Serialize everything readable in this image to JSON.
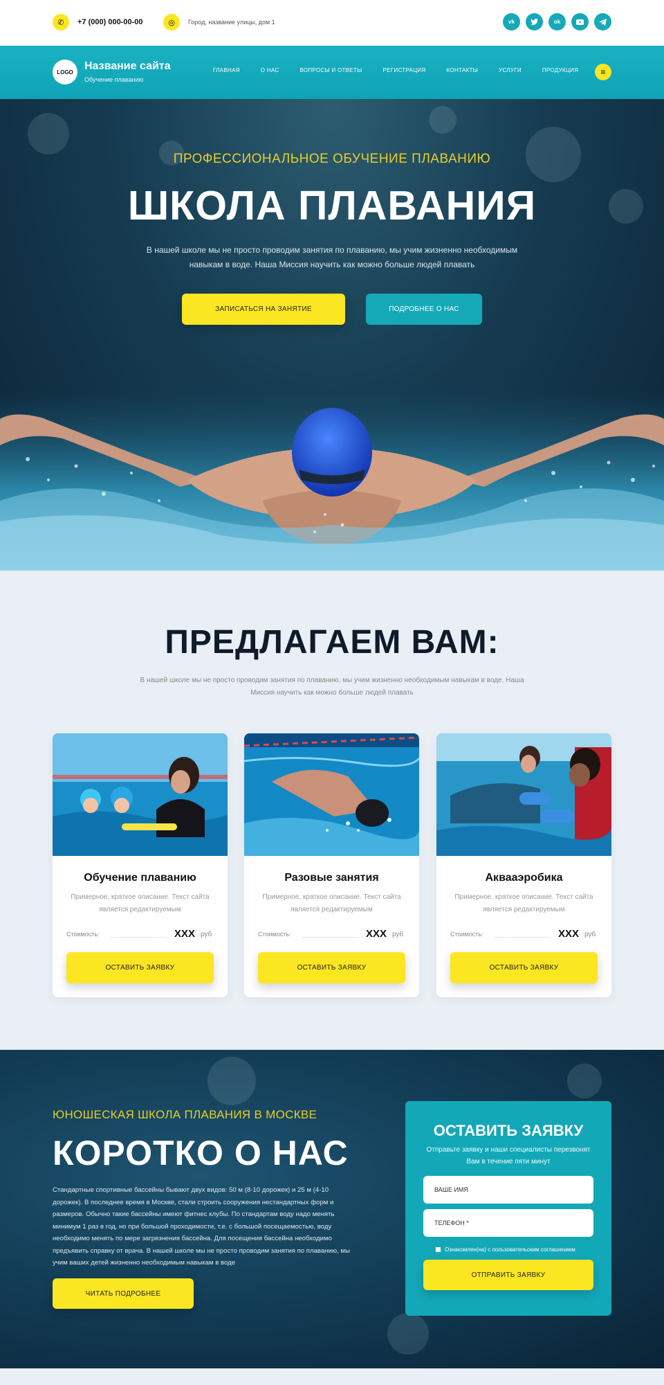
{
  "topbar": {
    "phone": "+7 (000) 000-00-00",
    "address": "Город, название улицы, дом 1",
    "socials": [
      "vk",
      "tw",
      "ok",
      "yt",
      "tg"
    ]
  },
  "header": {
    "logo": "LOGO",
    "site_title": "Название сайта",
    "site_subtitle": "Обучение плаванию",
    "menu": [
      "Главная",
      "О нас",
      "Вопросы и ответы",
      "Регистрация",
      "Контакты",
      "Услуги",
      "Продукция"
    ],
    "burger_icon": "≡"
  },
  "hero": {
    "eyebrow": "ПРОФЕССИОНАЛЬНОЕ ОБУЧЕНИЕ ПЛАВАНИЮ",
    "title": "ШКОЛА ПЛАВАНИЯ",
    "text": "В нашей школе мы не просто проводим занятия по плаванию, мы учим жизненно необходимым навыкам в воде. Наша Миссия научить как можно больше людей плавать",
    "primary_button": "ЗАПИСАТЬСЯ НА ЗАНЯТИЕ",
    "secondary_button": "ПОДРОБНЕЕ О НАС"
  },
  "offers": {
    "title": "ПРЕДЛАГАЕМ ВАМ:",
    "text": "В нашей школе мы не просто проводим занятия по плаванию, мы учим жизненно необходимым навыкам в воде. Наша Миссия научить как можно больше людей плавать",
    "cards": [
      {
        "title": "Обучение плаванию",
        "desc": "Примерное, краткое описание. Текст сайта является редактируемым",
        "price_label": "Стоимость:",
        "price": "XXX",
        "currency": "руб",
        "button": "ОСТАВИТЬ ЗАЯВКУ"
      },
      {
        "title": "Разовые занятия",
        "desc": "Примерное, краткое описание. Текст сайта является редактируемым",
        "price_label": "Стоимость:",
        "price": "XXX",
        "currency": "руб",
        "button": "ОСТАВИТЬ ЗАЯВКУ"
      },
      {
        "title": "Аквааэробика",
        "desc": "Примерное, краткое описание. Текст сайта является редактируемым",
        "price_label": "Стоимость:",
        "price": "XXX",
        "currency": "руб",
        "button": "ОСТАВИТЬ ЗАЯВКУ"
      }
    ]
  },
  "about": {
    "eyebrow": "ЮНОШЕСКАЯ ШКОЛА ПЛАВАНИЯ В МОСКВЕ",
    "title": "КОРОТКО О НАС",
    "text": "Стандартные спортивные бассейны бывают двух видов: 50 м (8-10 дорожек) и 25 м (4-10 дорожек). В последнее время в Москве, стали строить сооружения нестандартных форм и размеров. Обычно такие бассейны имеют фитнес клубы. По стандартам воду надо менять минимум 1 раз в год, но при большой проходимости, т.е. с большой посещаемостью, воду необходимо менять по мере загрязнения бассейна. Для посещения бассейна необходимо предъявить справку от врача. В нашей школе мы не просто проводим занятия по плаванию, мы учим ваших детей жизненно необходимым навыкам в воде",
    "button": "ЧИТАТЬ ПОДРОБНЕЕ"
  },
  "form": {
    "title": "ОСТАВИТЬ ЗАЯВКУ",
    "subtitle": "Отправьте заявку и наши специалисты перезвонят Вам в течение пяти минут",
    "name_placeholder": "Ваше имя",
    "phone_placeholder": "Телефон *",
    "agreement": "Ознакомлен(на) с пользовательским соглашением",
    "button": "ОТПРАВИТЬ ЗАЯВКУ"
  },
  "colors": {
    "accent": "#fbe622",
    "teal": "#16a9b8",
    "dark": "#0f1b29"
  }
}
